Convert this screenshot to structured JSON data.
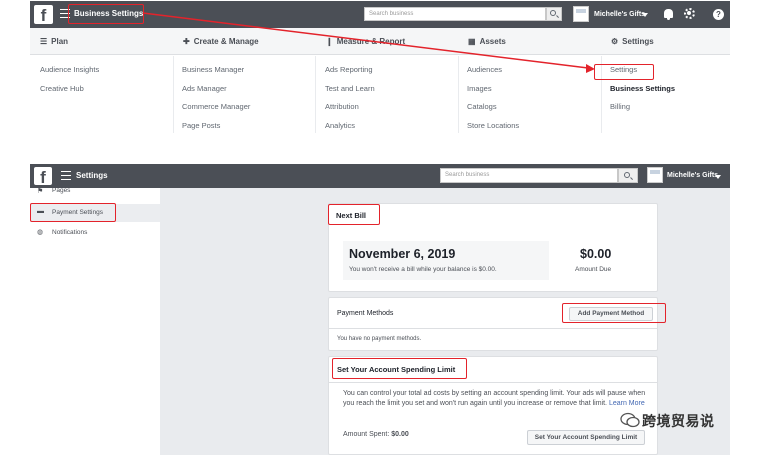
{
  "top": {
    "brand_glyph": "f",
    "title": "Business Settings",
    "search_placeholder": "Search business",
    "account_name": "Michelle's Gifts",
    "help_glyph": "?",
    "menu": [
      {
        "label": "Plan",
        "icon": "list-icon",
        "glyph": "☰"
      },
      {
        "label": "Create & Manage",
        "icon": "plus-icon",
        "glyph": "✚"
      },
      {
        "label": "Measure & Report",
        "icon": "bar-chart-icon",
        "glyph": "❙"
      },
      {
        "label": "Assets",
        "icon": "grid-icon",
        "glyph": "▦"
      },
      {
        "label": "Settings",
        "icon": "gear-icon",
        "glyph": "⚙"
      }
    ],
    "columns": [
      [
        "Audience Insights",
        "Creative Hub"
      ],
      [
        "Business Manager",
        "Ads Manager",
        "Commerce Manager",
        "Page Posts"
      ],
      [
        "Ads Reporting",
        "Test and Learn",
        "Attribution",
        "Analytics"
      ],
      [
        "Audiences",
        "Images",
        "Catalogs",
        "Store Locations"
      ],
      [
        "Settings",
        "Business Settings",
        "Billing"
      ]
    ]
  },
  "bottom": {
    "title": "Settings",
    "search_placeholder": "Search business",
    "account_name": "Michelle's Gifts",
    "sidebar": [
      {
        "label": "Pages",
        "icon": "flag-icon",
        "glyph": "⚑"
      },
      {
        "label": "Payment Settings",
        "icon": "credit-card-icon",
        "glyph": "▬"
      },
      {
        "label": "Notifications",
        "icon": "globe-icon",
        "glyph": "◍"
      }
    ],
    "next_bill": {
      "title": "Next Bill",
      "date": "November 6, 2019",
      "note": "You won't receive a bill while your balance is $0.00.",
      "amount": "$0.00",
      "amount_label": "Amount Due"
    },
    "payment_methods": {
      "title": "Payment Methods",
      "button": "Add Payment Method",
      "empty": "You have no payment methods."
    },
    "spending_limit": {
      "title": "Set Your Account Spending Limit",
      "description": "You can control your total ad costs by setting an account spending limit. Your ads will pause when you reach the limit you set and won't run again until you increase or remove that limit.",
      "learn_more": "Learn More",
      "amount_spent_label": "Amount Spent:",
      "amount_spent_value": "$0.00",
      "button": "Set Your Account Spending Limit"
    }
  },
  "watermark": {
    "text": "跨境贸易说"
  },
  "colors": {
    "topbar": "#4b4f56",
    "highlight": "#e3232b",
    "link": "#4267b2",
    "page_bg": "#e9ebee"
  }
}
